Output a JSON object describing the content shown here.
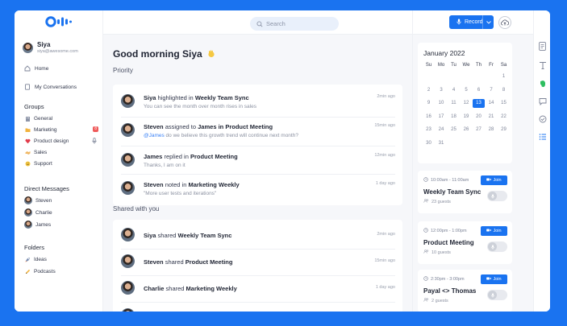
{
  "brand": {
    "logo_text": "Ollı"
  },
  "user": {
    "name": "Siya",
    "email": "siya@awesome.com"
  },
  "nav": {
    "home": "Home",
    "conversations": "My Conversations"
  },
  "groups": {
    "title": "Groups",
    "items": [
      {
        "label": "General",
        "icon": "building-emoji"
      },
      {
        "label": "Marketing",
        "icon": "folder-emoji",
        "badge": "8"
      },
      {
        "label": "Product design",
        "icon": "heart-emoji"
      },
      {
        "label": "Sales",
        "icon": "handshake-emoji"
      },
      {
        "label": "Support",
        "icon": "smile-emoji"
      }
    ]
  },
  "dms": {
    "title": "Direct Messages",
    "items": [
      "Steven",
      "Charlie",
      "James"
    ]
  },
  "folders": {
    "title": "Folders",
    "items": [
      {
        "label": "Ideas",
        "icon": "rocket-emoji"
      },
      {
        "label": "Podcasts",
        "icon": "pencil-emoji"
      }
    ]
  },
  "search": {
    "placeholder": "Search"
  },
  "greeting": "Good morning Siya",
  "priority": {
    "title": "Priority",
    "items": [
      {
        "name": "Siya",
        "action": " highlighted in ",
        "target": "Weekly Team Sync",
        "message": "You can see the month over month rises in sales",
        "time": "2min ago"
      },
      {
        "name": "Steven",
        "action": " assigned to ",
        "target": "James in Product Meeting",
        "mention": "@James",
        "message": " do we believe this growth trend will continue next month?",
        "time": "15min ago"
      },
      {
        "name": "James",
        "action": " replied in ",
        "target": "Product Meeting",
        "message": "Thanks, I am on it",
        "time": "12min ago"
      },
      {
        "name": "Steven",
        "action": " noted in ",
        "target": "Marketing Weekly",
        "message": "\"More user tests and iterations\"",
        "time": "1 day ago"
      }
    ]
  },
  "shared": {
    "title": "Shared with you",
    "items": [
      {
        "name": "Siya",
        "action": " shared ",
        "target": "Weekly Team Sync",
        "time": "2min ago"
      },
      {
        "name": "Steven",
        "action": " shared ",
        "target": "Product Meeting",
        "time": "15min ago"
      },
      {
        "name": "Charlie",
        "action": " shared ",
        "target": "Marketing Weekly",
        "time": "1 day ago"
      }
    ]
  },
  "toolbar": {
    "record_label": "Record"
  },
  "calendar": {
    "title": "January 2022",
    "weekdays": [
      "Su",
      "Mo",
      "Tu",
      "We",
      "Th",
      "Fr",
      "Sa"
    ],
    "weeks": [
      [
        "",
        "",
        "",
        "",
        "",
        "",
        "1"
      ],
      [
        "2",
        "3",
        "4",
        "5",
        "6",
        "7",
        "8"
      ],
      [
        "9",
        "10",
        "11",
        "12",
        "13",
        "14",
        "15"
      ],
      [
        "16",
        "17",
        "18",
        "19",
        "20",
        "21",
        "22"
      ],
      [
        "23",
        "24",
        "25",
        "26",
        "27",
        "28",
        "29"
      ],
      [
        "30",
        "31",
        "",
        "",
        "",
        "",
        ""
      ]
    ],
    "today": "13"
  },
  "events": [
    {
      "time": "10:00am - 11:00am",
      "title": "Weekly Team Sync",
      "guests": "23 guests",
      "join": "Join"
    },
    {
      "time": "12:00pm - 1:00pm",
      "title": "Product Meeting",
      "guests": "10 guests",
      "join": "Join"
    },
    {
      "time": "2:30pm - 3:00pm",
      "title": "Payal <> Thomas",
      "guests": "2 guests",
      "join": "Join"
    }
  ],
  "colors": {
    "accent": "#1a73f0",
    "background": "#1a73f0",
    "badge": "#ef5a5a",
    "mention": "#3b82f6"
  }
}
